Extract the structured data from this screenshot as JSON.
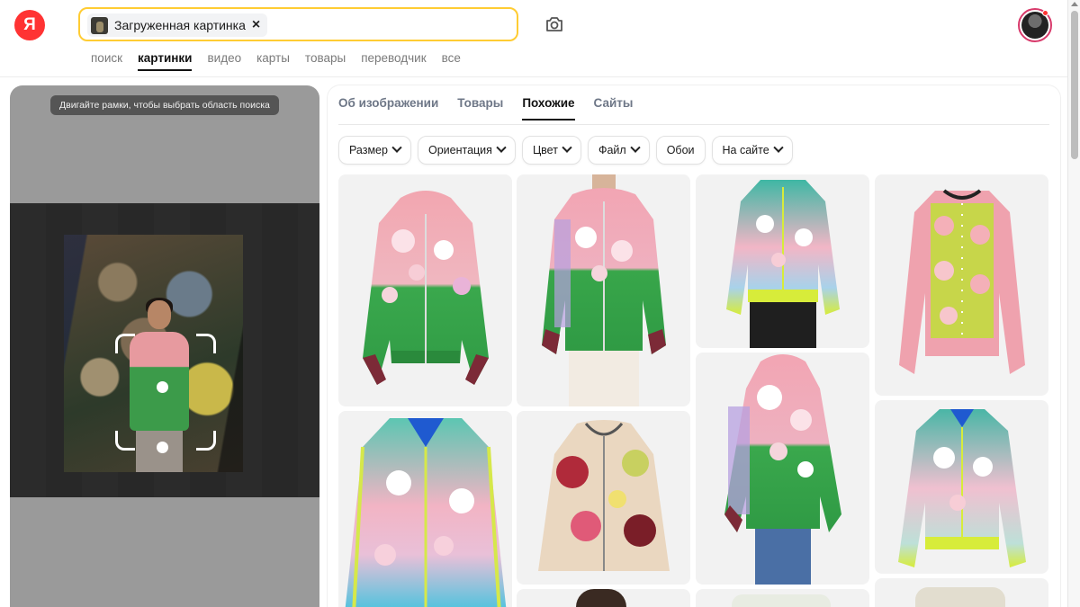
{
  "header": {
    "logo_text": "Я",
    "search_chip_label": "Загруженная картинка",
    "chip_close": "×"
  },
  "nav": {
    "items": [
      {
        "label": "поиск",
        "active": false
      },
      {
        "label": "картинки",
        "active": true
      },
      {
        "label": "видео",
        "active": false
      },
      {
        "label": "карты",
        "active": false
      },
      {
        "label": "товары",
        "active": false
      },
      {
        "label": "переводчик",
        "active": false
      },
      {
        "label": "все",
        "active": false
      }
    ]
  },
  "left_panel": {
    "hint": "Двигайте рамки, чтобы выбрать область поиска"
  },
  "right_panel": {
    "tabs": [
      {
        "label": "Об изображении",
        "active": false
      },
      {
        "label": "Товары",
        "active": false
      },
      {
        "label": "Похожие",
        "active": true
      },
      {
        "label": "Сайты",
        "active": false
      }
    ],
    "filters": [
      {
        "label": "Размер",
        "dropdown": true
      },
      {
        "label": "Ориентация",
        "dropdown": true
      },
      {
        "label": "Цвет",
        "dropdown": true
      },
      {
        "label": "Файл",
        "dropdown": true
      },
      {
        "label": "Обои",
        "dropdown": false
      },
      {
        "label": "На сайте",
        "dropdown": true
      }
    ]
  },
  "colors": {
    "accent_yellow": "#ffcc33",
    "logo_red": "#ff3333",
    "tab_inactive": "#6e7787"
  }
}
